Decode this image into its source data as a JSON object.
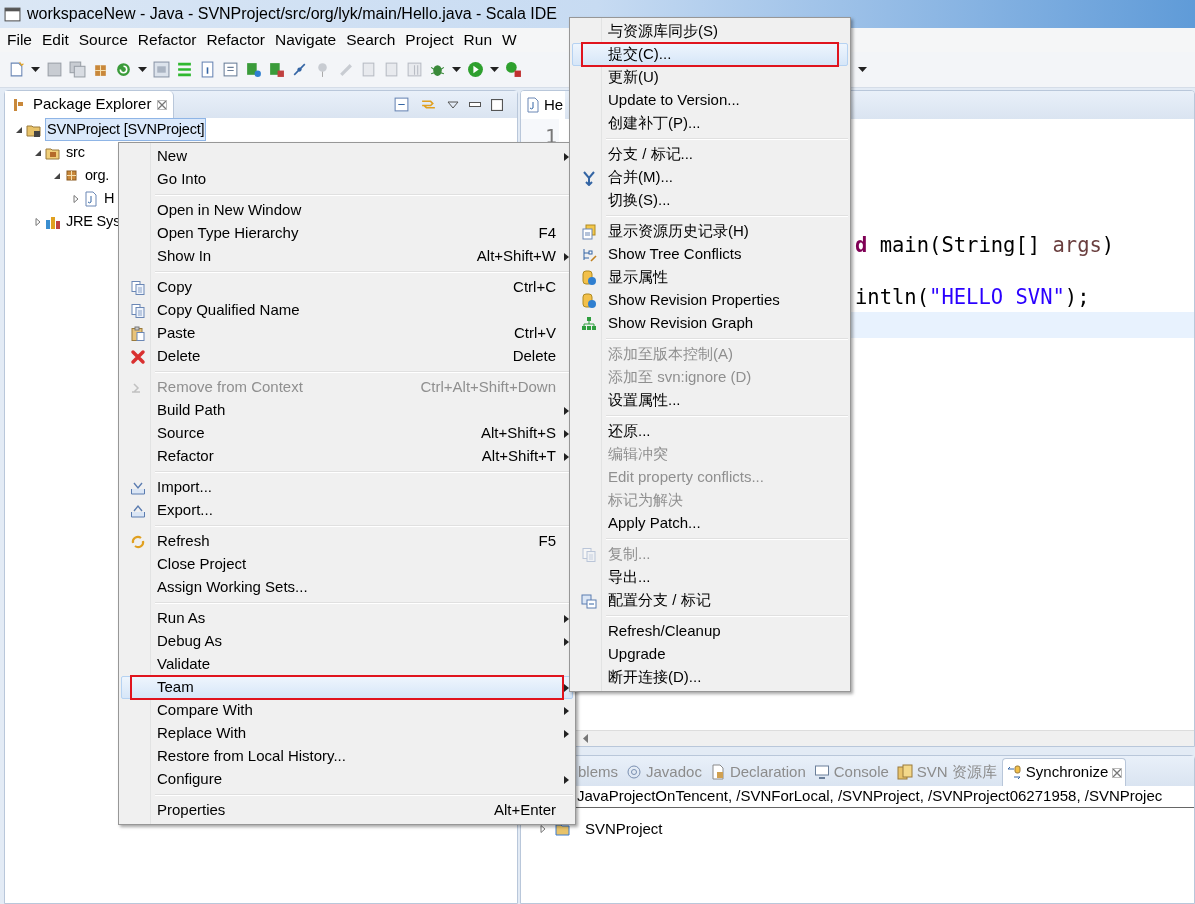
{
  "window": {
    "title": "workspaceNew - Java - SVNProject/src/org/lyk/main/Hello.java - Scala IDE"
  },
  "menu_bar": [
    "File",
    "Edit",
    "Source",
    "Refactor",
    "Refactor",
    "Navigate",
    "Search",
    "Project",
    "Run",
    "W"
  ],
  "package_explorer": {
    "tab": "Package Explorer",
    "tree": [
      {
        "label": "SVNProject [SVNProject]",
        "kind": "project",
        "expanded": true,
        "selected": true,
        "children": [
          {
            "label": "src",
            "kind": "source-folder",
            "expanded": true,
            "selected": false,
            "children": [
              {
                "label": "org.",
                "kind": "package",
                "expanded": true,
                "selected": false,
                "children": [
                  {
                    "label": "H",
                    "kind": "java-file",
                    "expanded": false,
                    "selected": false
                  }
                ]
              }
            ]
          },
          {
            "label": "JRE Sys",
            "kind": "library",
            "expanded": false,
            "selected": false
          }
        ]
      }
    ]
  },
  "editor": {
    "tab": "He",
    "line_number": "1",
    "lines": [
      {
        "segments": [
          {
            "kind": "keyword",
            "text": "d"
          },
          {
            "kind": "plain",
            "text": " main(String[] "
          },
          {
            "kind": "variable",
            "text": "args"
          },
          {
            "kind": "plain",
            "text": ")"
          }
        ]
      },
      {
        "segments": [
          {
            "kind": "plain",
            "text": "intln("
          },
          {
            "kind": "string",
            "text": "\"HELLO SVN\""
          },
          {
            "kind": "plain",
            "text": ");"
          }
        ]
      }
    ]
  },
  "bottom_panel": {
    "tabs": [
      {
        "label": "blems",
        "selected": false
      },
      {
        "label": "Javadoc",
        "kind": "javadoc",
        "selected": false
      },
      {
        "label": "Declaration",
        "kind": "declaration",
        "selected": false
      },
      {
        "label": "Console",
        "kind": "console",
        "selected": false
      },
      {
        "label": "SVN 资源库",
        "kind": "repository",
        "selected": false
      },
      {
        "label": "Synchronize",
        "kind": "synchronize",
        "selected": true
      }
    ],
    "path": "JavaProjectOnTencent, /SVNForLocal, /SVNProject, /SVNProject06271958, /SVNProjec",
    "tree": [
      {
        "label": "SVNProject",
        "expanded": false
      }
    ]
  },
  "context_menu": {
    "groups": [
      [
        {
          "label": "New",
          "submenu": true,
          "disabled": false,
          "selected": false,
          "marked": false
        },
        {
          "label": "Go Into",
          "submenu": false,
          "disabled": false,
          "selected": false,
          "marked": false
        }
      ],
      [
        {
          "label": "Open in New Window",
          "submenu": false,
          "disabled": false,
          "selected": false,
          "marked": false
        },
        {
          "label": "Open Type Hierarchy",
          "shortcut": "F4",
          "submenu": false,
          "disabled": false,
          "selected": false,
          "marked": false
        },
        {
          "label": "Show In",
          "shortcut": "Alt+Shift+W",
          "submenu": true,
          "disabled": false,
          "selected": false,
          "marked": false
        }
      ],
      [
        {
          "label": "Copy",
          "shortcut": "Ctrl+C",
          "kind": "copy",
          "submenu": false,
          "disabled": false,
          "selected": false,
          "marked": false
        },
        {
          "label": "Copy Qualified Name",
          "kind": "copy",
          "submenu": false,
          "disabled": false,
          "selected": false,
          "marked": false
        },
        {
          "label": "Paste",
          "shortcut": "Ctrl+V",
          "kind": "paste",
          "submenu": false,
          "disabled": false,
          "selected": false,
          "marked": false
        },
        {
          "label": "Delete",
          "shortcut": "Delete",
          "kind": "delete",
          "submenu": false,
          "disabled": false,
          "selected": false,
          "marked": false
        }
      ],
      [
        {
          "label": "Remove from Context",
          "shortcut": "Ctrl+Alt+Shift+Down",
          "kind": "context",
          "submenu": false,
          "disabled": true,
          "selected": false,
          "marked": false
        },
        {
          "label": "Build Path",
          "submenu": true,
          "disabled": false,
          "selected": false,
          "marked": false
        },
        {
          "label": "Source",
          "shortcut": "Alt+Shift+S",
          "submenu": true,
          "disabled": false,
          "selected": false,
          "marked": false
        },
        {
          "label": "Refactor",
          "shortcut": "Alt+Shift+T",
          "submenu": true,
          "disabled": false,
          "selected": false,
          "marked": false
        }
      ],
      [
        {
          "label": "Import...",
          "kind": "import",
          "submenu": false,
          "disabled": false,
          "selected": false,
          "marked": false
        },
        {
          "label": "Export...",
          "kind": "export",
          "submenu": false,
          "disabled": false,
          "selected": false,
          "marked": false
        }
      ],
      [
        {
          "label": "Refresh",
          "shortcut": "F5",
          "kind": "refresh",
          "submenu": false,
          "disabled": false,
          "selected": false,
          "marked": false
        },
        {
          "label": "Close Project",
          "submenu": false,
          "disabled": false,
          "selected": false,
          "marked": false
        },
        {
          "label": "Assign Working Sets...",
          "submenu": false,
          "disabled": false,
          "selected": false,
          "marked": false
        }
      ],
      [
        {
          "label": "Run As",
          "submenu": true,
          "disabled": false,
          "selected": false,
          "marked": false
        },
        {
          "label": "Debug As",
          "submenu": true,
          "disabled": false,
          "selected": false,
          "marked": false
        },
        {
          "label": "Validate",
          "submenu": false,
          "disabled": false,
          "selected": false,
          "marked": false
        },
        {
          "label": "Team",
          "submenu": true,
          "disabled": false,
          "selected": true,
          "marked": true
        },
        {
          "label": "Compare With",
          "submenu": true,
          "disabled": false,
          "selected": false,
          "marked": false
        },
        {
          "label": "Replace With",
          "submenu": true,
          "disabled": false,
          "selected": false,
          "marked": false
        },
        {
          "label": "Restore from Local History...",
          "submenu": false,
          "disabled": false,
          "selected": false,
          "marked": false
        },
        {
          "label": "Configure",
          "submenu": true,
          "disabled": false,
          "selected": false,
          "marked": false
        }
      ],
      [
        {
          "label": "Properties",
          "shortcut": "Alt+Enter",
          "submenu": false,
          "disabled": false,
          "selected": false,
          "marked": false
        }
      ]
    ]
  },
  "team_submenu": {
    "groups": [
      [
        {
          "label": "与资源库同步(S)",
          "submenu": false,
          "disabled": false,
          "selected": false,
          "marked": false
        },
        {
          "label": "提交(C)...",
          "submenu": false,
          "disabled": false,
          "selected": true,
          "marked": true
        },
        {
          "label": "更新(U)",
          "submenu": false,
          "disabled": false,
          "selected": false,
          "marked": false
        },
        {
          "label": "Update to Version...",
          "submenu": false,
          "disabled": false,
          "selected": false,
          "marked": false
        },
        {
          "label": "创建补丁(P)...",
          "submenu": false,
          "disabled": false,
          "selected": false,
          "marked": false
        }
      ],
      [
        {
          "label": "分支 / 标记...",
          "submenu": false,
          "disabled": false,
          "selected": false,
          "marked": false
        },
        {
          "label": "合并(M)...",
          "kind": "merge",
          "submenu": false,
          "disabled": false,
          "selected": false,
          "marked": false
        },
        {
          "label": "切换(S)...",
          "submenu": false,
          "disabled": false,
          "selected": false,
          "marked": false
        }
      ],
      [
        {
          "label": "显示资源历史记录(H)",
          "kind": "history",
          "submenu": false,
          "disabled": false,
          "selected": false,
          "marked": false
        },
        {
          "label": "Show Tree Conflicts",
          "kind": "tree-conflicts",
          "submenu": false,
          "disabled": false,
          "selected": false,
          "marked": false
        },
        {
          "label": "显示属性",
          "kind": "properties",
          "submenu": false,
          "disabled": false,
          "selected": false,
          "marked": false
        },
        {
          "label": "Show Revision Properties",
          "kind": "properties",
          "submenu": false,
          "disabled": false,
          "selected": false,
          "marked": false
        },
        {
          "label": "Show Revision Graph",
          "kind": "graph",
          "submenu": false,
          "disabled": false,
          "selected": false,
          "marked": false
        }
      ],
      [
        {
          "label": "添加至版本控制(A)",
          "submenu": false,
          "disabled": true,
          "selected": false,
          "marked": false
        },
        {
          "label": "添加至 svn:ignore (D)",
          "submenu": false,
          "disabled": true,
          "selected": false,
          "marked": false
        },
        {
          "label": "设置属性...",
          "submenu": false,
          "disabled": false,
          "selected": false,
          "marked": false
        }
      ],
      [
        {
          "label": "还原...",
          "submenu": false,
          "disabled": false,
          "selected": false,
          "marked": false
        },
        {
          "label": "编辑冲突",
          "submenu": false,
          "disabled": true,
          "selected": false,
          "marked": false
        },
        {
          "label": "Edit property conflicts...",
          "submenu": false,
          "disabled": true,
          "selected": false,
          "marked": false
        },
        {
          "label": "标记为解决",
          "submenu": false,
          "disabled": true,
          "selected": false,
          "marked": false
        },
        {
          "label": "Apply Patch...",
          "submenu": false,
          "disabled": false,
          "selected": false,
          "marked": false
        }
      ],
      [
        {
          "label": "复制...",
          "kind": "copy",
          "submenu": false,
          "disabled": true,
          "selected": false,
          "marked": false
        },
        {
          "label": "导出...",
          "submenu": false,
          "disabled": false,
          "selected": false,
          "marked": false
        },
        {
          "label": "配置分支 / 标记",
          "kind": "branches",
          "submenu": false,
          "disabled": false,
          "selected": false,
          "marked": false
        }
      ],
      [
        {
          "label": "Refresh/Cleanup",
          "submenu": false,
          "disabled": false,
          "selected": false,
          "marked": false
        },
        {
          "label": "Upgrade",
          "submenu": false,
          "disabled": false,
          "selected": false,
          "marked": false
        },
        {
          "label": "断开连接(D)...",
          "submenu": false,
          "disabled": false,
          "selected": false,
          "marked": false
        }
      ]
    ]
  }
}
